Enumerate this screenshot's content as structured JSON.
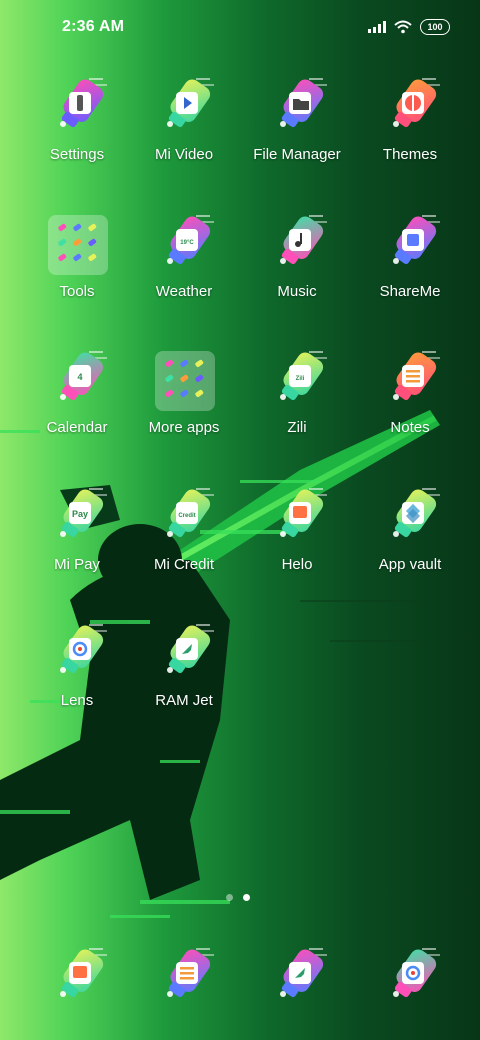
{
  "status": {
    "time": "2:36 AM",
    "battery": "100",
    "icons": [
      "signal-icon",
      "wifi-icon",
      "battery-icon"
    ]
  },
  "apps": [
    {
      "label": "Settings",
      "glyph": "sliders",
      "colors": [
        "#ff4fb8",
        "#6a5cff"
      ]
    },
    {
      "label": "Mi Video",
      "glyph": "play",
      "colors": [
        "#e7f25a",
        "#38d6a0"
      ]
    },
    {
      "label": "File Manager",
      "glyph": "folder",
      "colors": [
        "#ff4fb8",
        "#5a7bff"
      ]
    },
    {
      "label": "Themes",
      "glyph": "brush",
      "colors": [
        "#ff9c3a",
        "#ff4f7a"
      ]
    },
    {
      "label": "Tools",
      "glyph": "folder-grid",
      "colors": [
        "#ffffff",
        "#ffffff"
      ]
    },
    {
      "label": "Weather",
      "glyph": "19°C",
      "colors": [
        "#ff4fb8",
        "#5a7bff"
      ]
    },
    {
      "label": "Music",
      "glyph": "note",
      "colors": [
        "#3fe0a4",
        "#ff4fb8"
      ]
    },
    {
      "label": "ShareMe",
      "glyph": "share",
      "colors": [
        "#ff4fb8",
        "#5a7bff"
      ]
    },
    {
      "label": "Calendar",
      "glyph": "4",
      "colors": [
        "#3fe0a4",
        "#ff4fb8"
      ]
    },
    {
      "label": "More apps",
      "glyph": "folder-grid",
      "colors": [
        "#ffffff",
        "#ffffff"
      ]
    },
    {
      "label": "Zili",
      "glyph": "Zili",
      "colors": [
        "#e7f25a",
        "#38d6a0"
      ]
    },
    {
      "label": "Notes",
      "glyph": "lines",
      "colors": [
        "#ff9c3a",
        "#ff4f7a"
      ]
    },
    {
      "label": "Mi Pay",
      "glyph": "Pay",
      "colors": [
        "#e7f25a",
        "#38d6a0"
      ]
    },
    {
      "label": "Mi Credit",
      "glyph": "Credit",
      "colors": [
        "#e7f25a",
        "#38d6a0"
      ]
    },
    {
      "label": "Helo",
      "glyph": "chat",
      "colors": [
        "#e7f25a",
        "#38d6a0"
      ]
    },
    {
      "label": "App vault",
      "glyph": "stack",
      "colors": [
        "#e7f25a",
        "#38d6a0"
      ]
    },
    {
      "label": "Lens",
      "glyph": "lens",
      "colors": [
        "#e7f25a",
        "#38d6a0"
      ]
    },
    {
      "label": "RAM Jet",
      "glyph": "rocket",
      "colors": [
        "#e7f25a",
        "#38d6a0"
      ]
    }
  ],
  "dock": [
    {
      "name": "phone",
      "colors": [
        "#e7f25a",
        "#38d6a0"
      ]
    },
    {
      "name": "messages",
      "colors": [
        "#ff4fb8",
        "#5a7bff"
      ]
    },
    {
      "name": "browser",
      "colors": [
        "#ff4fb8",
        "#5a7bff"
      ]
    },
    {
      "name": "camera",
      "colors": [
        "#3fe0a4",
        "#ff4fb8"
      ]
    }
  ],
  "pager": {
    "pages": 2,
    "active": 2
  }
}
